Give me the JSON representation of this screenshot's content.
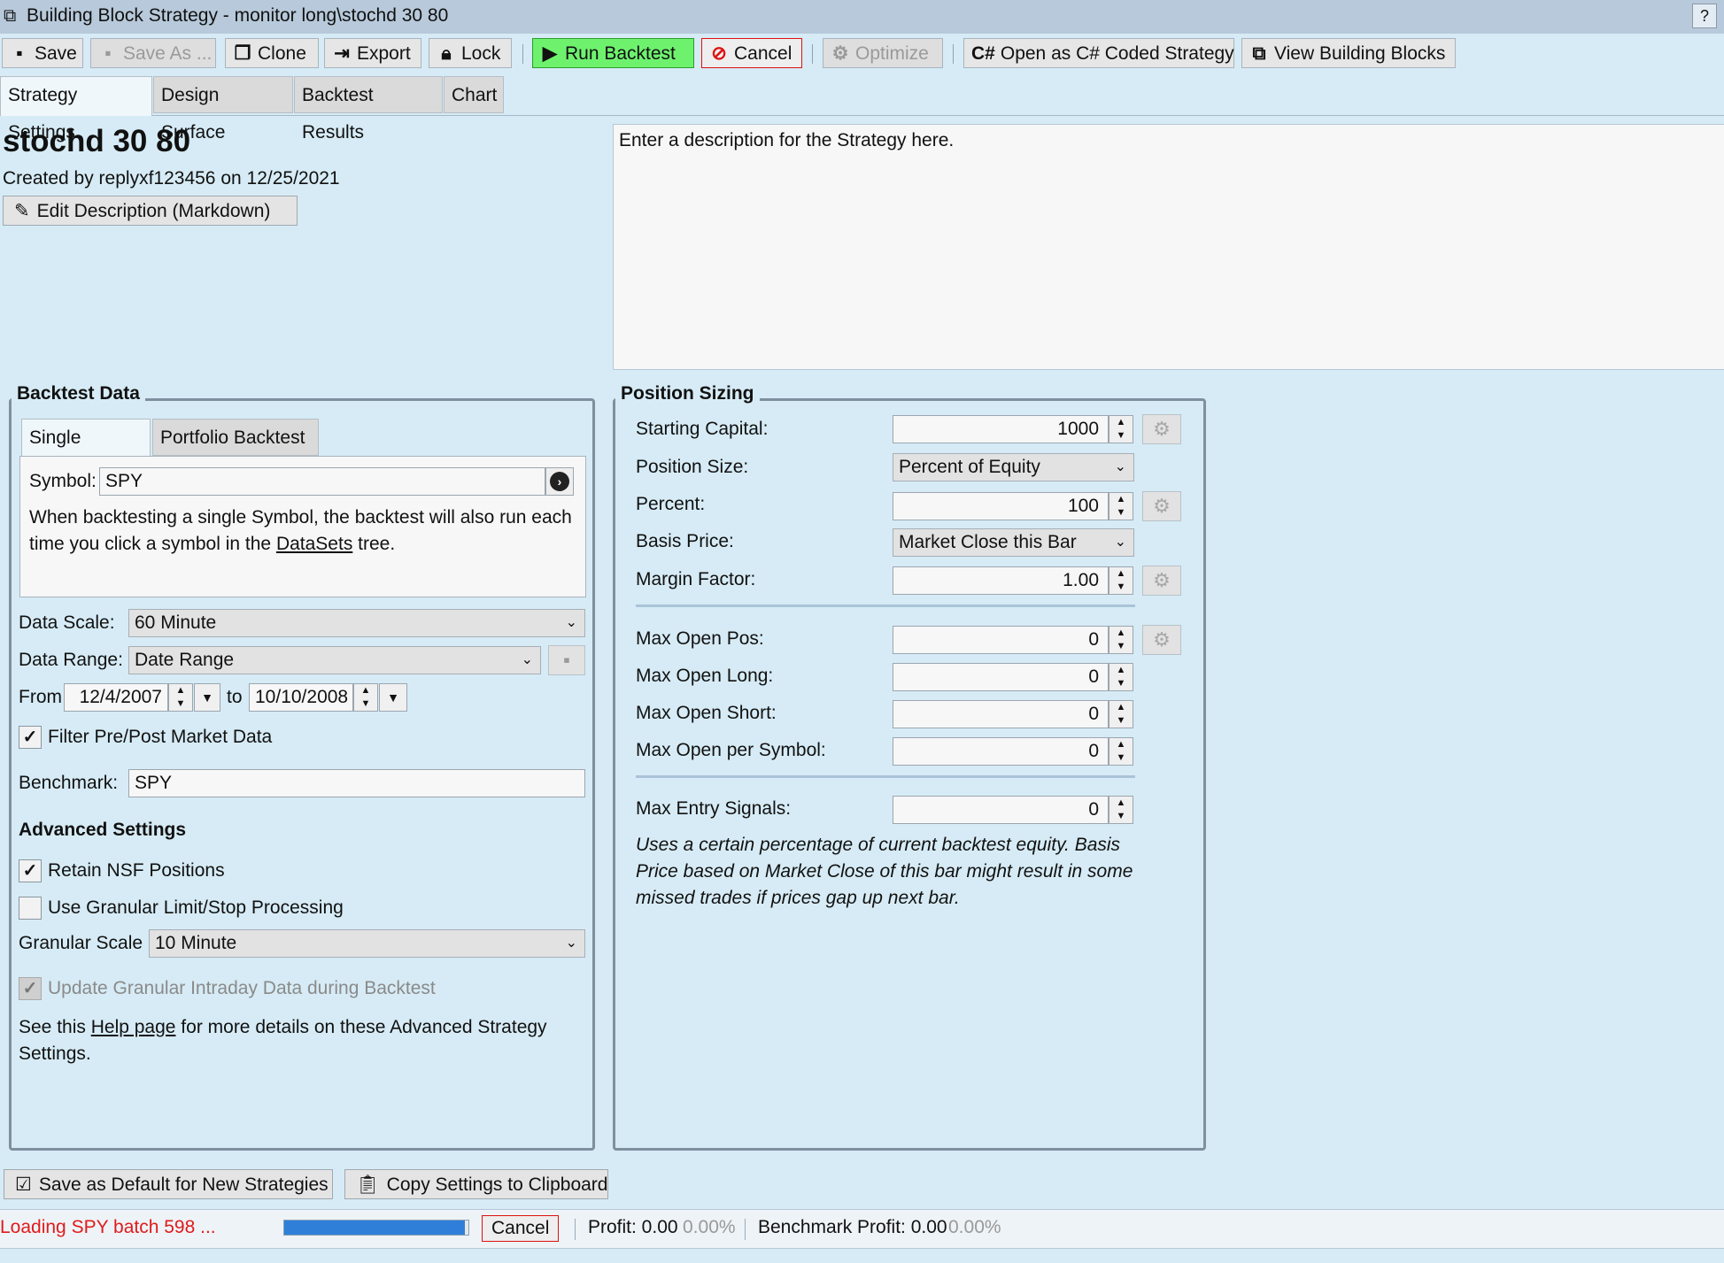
{
  "window": {
    "title": "Building Block Strategy - monitor long\\stochd 30 80",
    "help_label": "?"
  },
  "toolbar": {
    "save": "Save",
    "save_as": "Save As ...",
    "clone": "Clone",
    "export": "Export",
    "lock": "Lock",
    "run_backtest": "Run Backtest",
    "cancel": "Cancel",
    "optimize": "Optimize",
    "open_csharp": "Open as C# Coded Strategy",
    "view_building_blocks": "View Building Blocks",
    "csharp_prefix": "C#"
  },
  "tabs": [
    "Strategy Settings",
    "Design Surface",
    "Backtest Results",
    "Chart"
  ],
  "strategy": {
    "name": "stochd 30 80",
    "created": "Created by replyxf123456 on 12/25/2021",
    "edit_description": "Edit Description (Markdown)",
    "description": "Enter a description for the Strategy here."
  },
  "backtest_data": {
    "title": "Backtest Data",
    "subtabs": [
      "Single Symbol",
      "Portfolio Backtest"
    ],
    "symbol_label": "Symbol:",
    "symbol_value": "SPY",
    "info_text_1": "When backtesting a single Symbol, the backtest will also run each",
    "info_text_2a": "time you click a symbol in the ",
    "info_link": "DataSets",
    "info_text_2b": " tree.",
    "data_scale_label": "Data Scale:",
    "data_scale_value": "60 Minute",
    "data_range_label": "Data Range:",
    "data_range_value": "Date Range",
    "from_label": "From",
    "from_value": "12/4/2007",
    "to_label": "to",
    "to_value": "10/10/2008",
    "filter_label": "Filter Pre/Post Market Data",
    "filter_checked": true,
    "benchmark_label": "Benchmark:",
    "benchmark_value": "SPY",
    "advanced_title": "Advanced Settings",
    "retain_nsf_label": "Retain NSF Positions",
    "retain_nsf_checked": true,
    "granular_label": "Use Granular Limit/Stop Processing",
    "granular_checked": false,
    "granular_scale_label": "Granular Scale",
    "granular_scale_value": "10 Minute",
    "update_granular_label": "Update Granular Intraday Data during Backtest",
    "update_granular_checked": true,
    "help_text_1a": "See this ",
    "help_link": "Help page",
    "help_text_1b": " for more details on these Advanced Strategy",
    "help_text_2": "Settings."
  },
  "position_sizing": {
    "title": "Position Sizing",
    "starting_capital_label": "Starting Capital:",
    "starting_capital_value": "1000",
    "position_size_label": "Position Size:",
    "position_size_value": "Percent of Equity",
    "percent_label": "Percent:",
    "percent_value": "100",
    "basis_price_label": "Basis Price:",
    "basis_price_value": "Market Close this Bar",
    "margin_factor_label": "Margin Factor:",
    "margin_factor_value": "1.00",
    "max_open_pos_label": "Max Open Pos:",
    "max_open_pos_value": "0",
    "max_open_long_label": "Max Open Long:",
    "max_open_long_value": "0",
    "max_open_short_label": "Max Open Short:",
    "max_open_short_value": "0",
    "max_open_per_symbol_label": "Max Open per Symbol:",
    "max_open_per_symbol_value": "0",
    "max_entry_signals_label": "Max Entry Signals:",
    "max_entry_signals_value": "0",
    "note_1": "Uses a certain percentage of current backtest equity. Basis",
    "note_2": "Price based on Market Close of this bar might result in some",
    "note_3": "missed trades if prices gap up next bar."
  },
  "bottom": {
    "save_default": "Save as Default for New Strategies",
    "copy_settings": "Copy Settings to Clipboard"
  },
  "status": {
    "loading": "Loading SPY batch 598 ...",
    "progress_fraction": 0.98,
    "cancel": "Cancel",
    "profit_label": "Profit: 0.00",
    "profit_pct": "0.00%",
    "benchmark_label": "Benchmark Profit: 0.00",
    "benchmark_pct": "0.00%"
  },
  "colors": {
    "background": "#d6ebf5",
    "run_green": "#6ef26e",
    "cancel_red": "#dd1111",
    "progress_blue": "#2f7fd9"
  }
}
